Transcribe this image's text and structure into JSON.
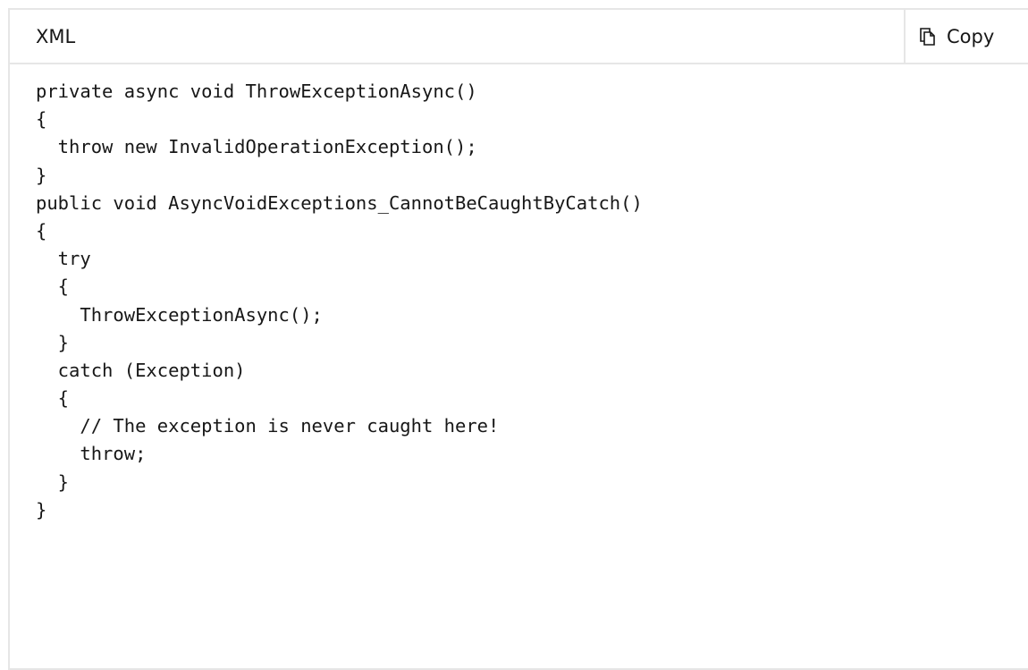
{
  "header": {
    "language": "XML",
    "copy_label": "Copy",
    "copy_icon": "copy-icon"
  },
  "code": {
    "lines": [
      "private async void ThrowExceptionAsync()",
      "{",
      "  throw new InvalidOperationException();",
      "}",
      "public void AsyncVoidExceptions_CannotBeCaughtByCatch()",
      "{",
      "  try",
      "  {",
      "    ThrowExceptionAsync();",
      "  }",
      "  catch (Exception)",
      "  {",
      "    // The exception is never caught here!",
      "    throw;",
      "  }",
      "}"
    ]
  }
}
